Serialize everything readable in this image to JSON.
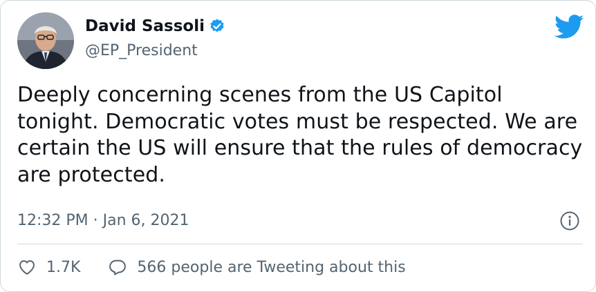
{
  "author": {
    "name": "David Sassoli",
    "handle": "@EP_President"
  },
  "tweet": {
    "text": "Deeply concerning scenes from the US Capitol tonight. Democratic votes must be respected. We are certain the US will ensure that the rules of democracy are protected.",
    "timestamp": "12:32 PM · Jan 6, 2021"
  },
  "actions": {
    "like_count": "1.7K",
    "reply_text": "566 people are Tweeting about this"
  },
  "icons": {
    "verified": "verified-badge-icon",
    "brand": "twitter-bird-icon",
    "info": "info-icon",
    "like": "heart-icon",
    "reply": "comment-bubble-icon"
  },
  "colors": {
    "brand": "#1d9bf0",
    "text": "#0f1419",
    "secondary": "#536471",
    "border": "#cfd9de"
  }
}
